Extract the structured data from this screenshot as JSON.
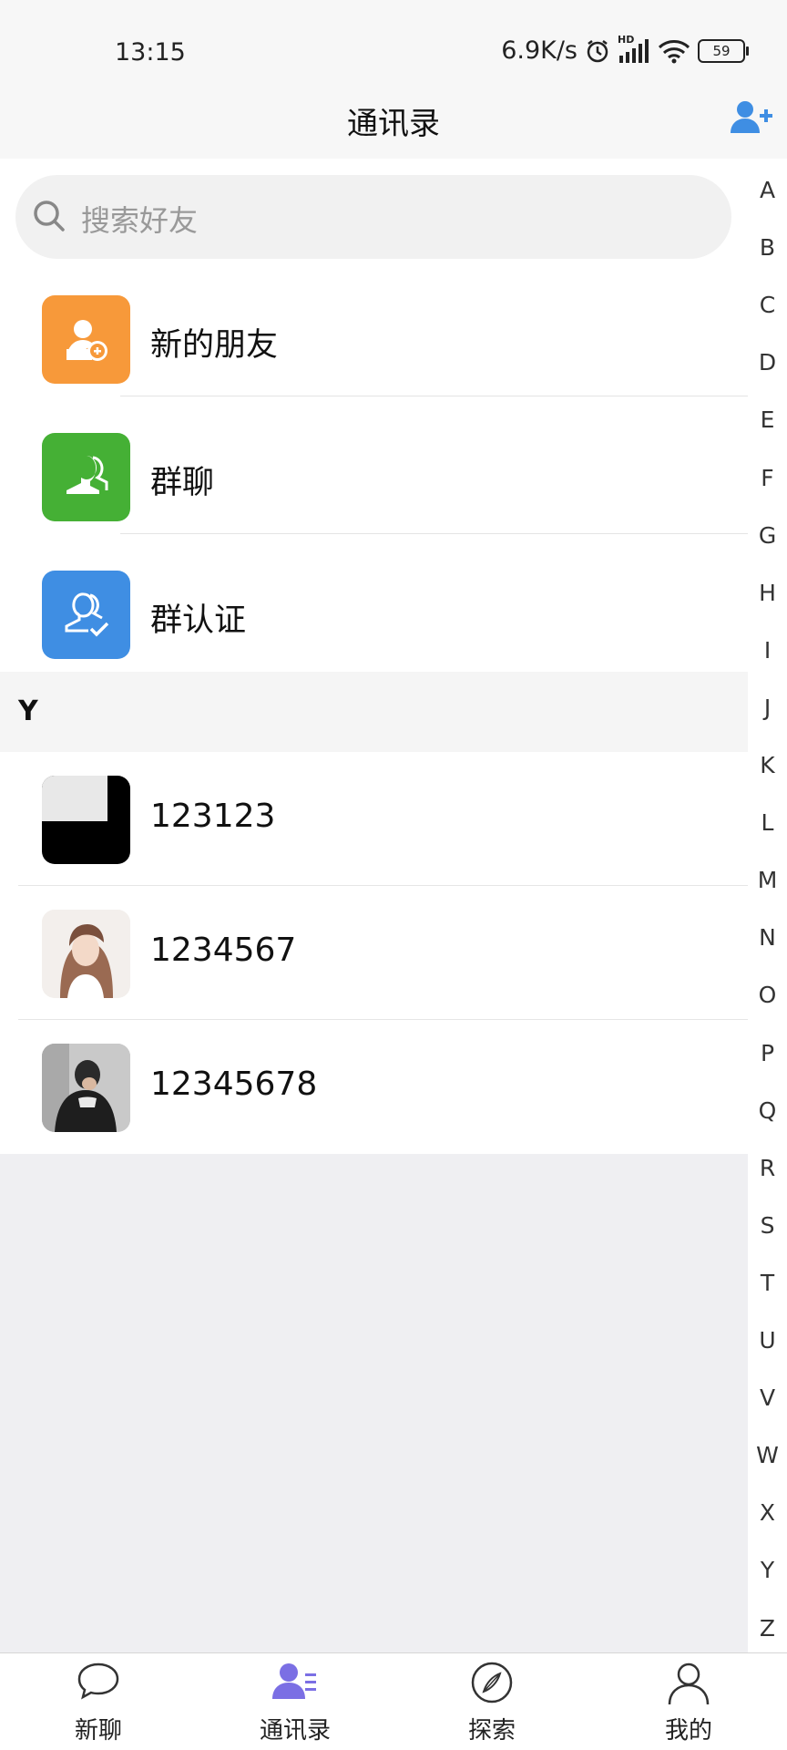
{
  "status_bar": {
    "time": "13:15",
    "network_speed": "6.9K/s",
    "network_type": "HD",
    "battery": "59"
  },
  "header": {
    "title": "通讯录",
    "add_icon": "add-friend-icon"
  },
  "search": {
    "placeholder": "搜索好友"
  },
  "functions": [
    {
      "label": "新的朋友",
      "icon": "new-friend-icon",
      "color": "#f7993a"
    },
    {
      "label": "群聊",
      "icon": "group-chat-icon",
      "color": "#45b035"
    },
    {
      "label": "群认证",
      "icon": "group-verify-icon",
      "color": "#3f8ee3"
    }
  ],
  "section": {
    "letter": "Y"
  },
  "contacts": [
    {
      "name": "123123",
      "avatar": "avatar-split-black-white"
    },
    {
      "name": "1234567",
      "avatar": "avatar-photo-girl"
    },
    {
      "name": "12345678",
      "avatar": "avatar-photo-boy"
    }
  ],
  "index_letters": [
    "A",
    "B",
    "C",
    "D",
    "E",
    "F",
    "G",
    "H",
    "I",
    "J",
    "K",
    "L",
    "M",
    "N",
    "O",
    "P",
    "Q",
    "R",
    "S",
    "T",
    "U",
    "V",
    "W",
    "X",
    "Y",
    "Z"
  ],
  "tabs": [
    {
      "label": "新聊",
      "icon": "chat-bubble-icon",
      "active": false
    },
    {
      "label": "通讯录",
      "icon": "contacts-icon",
      "active": true
    },
    {
      "label": "探索",
      "icon": "compass-icon",
      "active": false
    },
    {
      "label": "我的",
      "icon": "person-icon",
      "active": false
    }
  ],
  "colors": {
    "accent": "#3f8ee3",
    "active_tab_icon": "#7b6fe4"
  }
}
